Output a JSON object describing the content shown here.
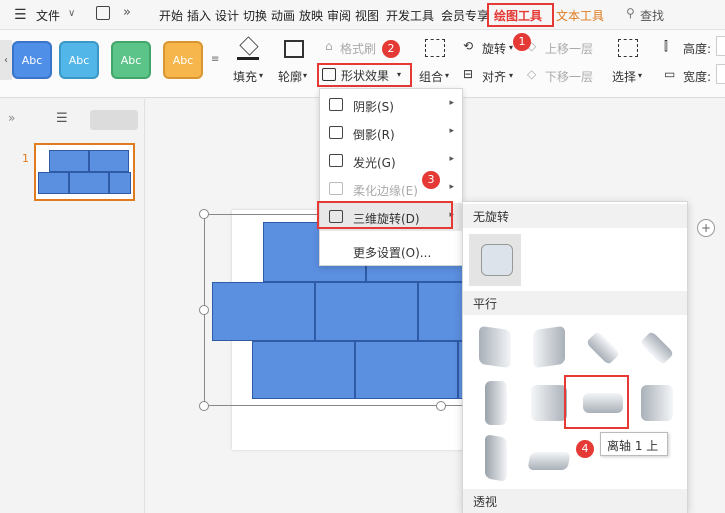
{
  "menubar": {
    "file": "文件",
    "tabs": [
      "开始",
      "插入",
      "设计",
      "切换",
      "动画",
      "放映",
      "审阅",
      "视图",
      "开发工具",
      "会员专享"
    ],
    "active_tab": "绘图工具",
    "text_tool": "文本工具",
    "search": "查找"
  },
  "ribbon": {
    "styles": [
      {
        "label": "Abc",
        "color": "#4f8fe8"
      },
      {
        "label": "Abc",
        "color": "#52b6e8"
      },
      {
        "label": "Abc",
        "color": "#5cc488"
      },
      {
        "label": "Abc",
        "color": "#f6b64c"
      }
    ],
    "fill": "填充",
    "outline": "轮廓",
    "format_brush": "格式刷",
    "shape_effect": "形状效果",
    "group": "组合",
    "rotate": "旋转",
    "align": "对齐",
    "bring_forward": "上移一层",
    "send_backward": "下移一层",
    "select": "选择",
    "height": "高度:",
    "width": "宽度:"
  },
  "slides": {
    "number": "1"
  },
  "shape_menu": {
    "items": [
      {
        "label": "阴影(S)",
        "arrow": "▸"
      },
      {
        "label": "倒影(R)",
        "arrow": "▸"
      },
      {
        "label": "发光(G)",
        "arrow": "▸"
      },
      {
        "label": "柔化边缘(E)",
        "arrow": "▸"
      },
      {
        "label": "三维旋转(D)",
        "arrow": "▸"
      },
      {
        "label": "更多设置(O)...",
        "arrow": ""
      }
    ]
  },
  "submenu": {
    "no_rotation": "无旋转",
    "parallel": "平行",
    "perspective": "透视"
  },
  "tooltip": "离轴 1 上",
  "badges": [
    "1",
    "2",
    "3",
    "4"
  ],
  "colors": {
    "highlight_red": "#e53935",
    "brick_blue": "#5b8fe0"
  }
}
